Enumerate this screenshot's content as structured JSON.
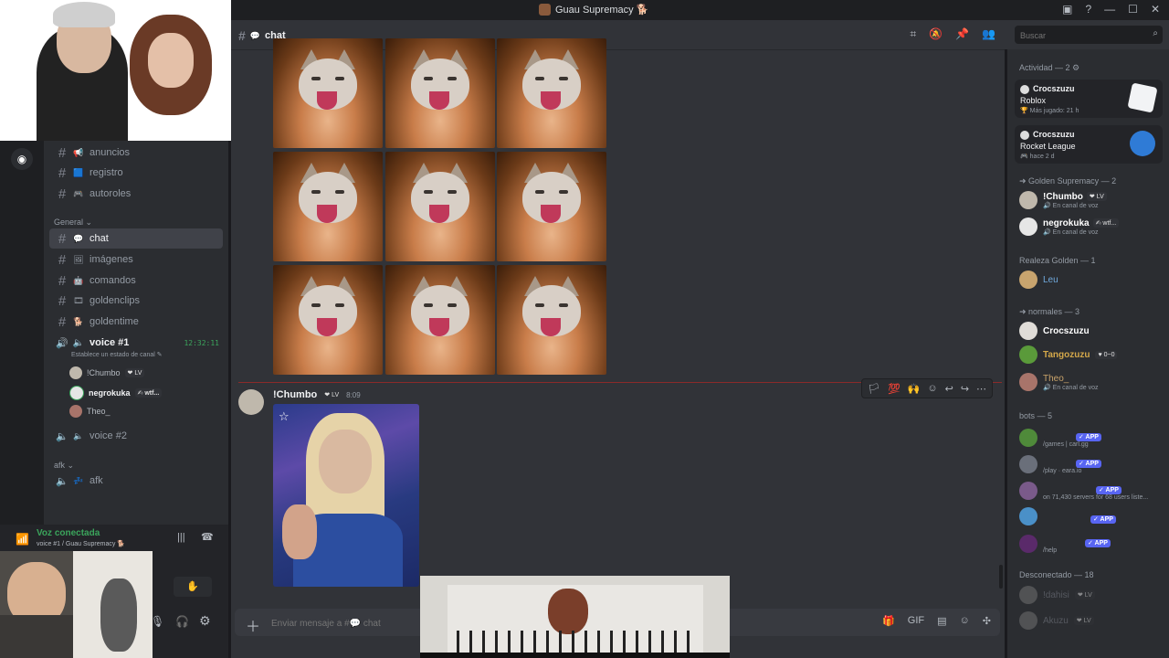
{
  "window": {
    "title": "Guau Supremacy 🐕"
  },
  "channels": {
    "items": [
      {
        "emoji": "📢",
        "name": "anuncios"
      },
      {
        "emoji": "🟦",
        "name": "registro"
      },
      {
        "emoji": "🎮",
        "name": "autoroles"
      }
    ],
    "general_label": "General ⌄",
    "general_items": [
      {
        "emoji": "💬",
        "name": "chat"
      },
      {
        "emoji": "🖼",
        "name": "imágenes"
      },
      {
        "emoji": "🤖",
        "name": "comandos"
      },
      {
        "emoji": "🎞",
        "name": "goldenclips"
      },
      {
        "emoji": "🐕",
        "name": "goldentime"
      }
    ],
    "voice1": {
      "name": "voice #1",
      "timer": "12:32:11",
      "status_prompt": "Establece un estado de canal ✎"
    },
    "voice_users": [
      {
        "name": "!Chumbo",
        "badge": "❤ LV"
      },
      {
        "name": "negrokuka",
        "badge": "✍ wtf..."
      },
      {
        "name": "Theo_",
        "badge": ""
      }
    ],
    "voice2": "voice #2",
    "afk_label": "afk ⌄",
    "afk_channel": "afk"
  },
  "voice_panel": {
    "status": "Voz conectada",
    "location": "voice #1 / Guau Supremacy 🐕"
  },
  "main": {
    "channel_name": "chat",
    "message": {
      "author": "!Chumbo",
      "badge": "❤ LV",
      "time": "8:09"
    },
    "input_placeholder": "Enviar mensaje a #💬 chat"
  },
  "search": {
    "placeholder": "Buscar"
  },
  "members": {
    "activity_header": "Actividad — 2 ⚙",
    "activity": [
      {
        "user": "Crocszuzu",
        "game": "Roblox",
        "detail": "🏆 Más jugado: 21 h"
      },
      {
        "user": "Crocszuzu",
        "game": "Rocket League",
        "detail": "🎮 hace 2 d"
      }
    ],
    "sections": [
      {
        "header": "➜ Golden Supremacy — 2",
        "members": [
          {
            "name": "!Chumbo",
            "tag": "❤ LV",
            "status": "🔊 En canal de voz",
            "color": "#ffffff"
          },
          {
            "name": "negrokuka",
            "tag": "✍ wtf...",
            "status": "🔊 En canal de voz",
            "color": "#ffffff"
          }
        ]
      },
      {
        "header": "Realeza Golden — 1",
        "members": [
          {
            "name": "Leu",
            "tag": "",
            "status": "",
            "color": "#6fa8dc"
          }
        ]
      },
      {
        "header": "➜ normales — 3",
        "members": [
          {
            "name": "Crocszuzu",
            "tag": "",
            "status": "",
            "color": "#ffffff"
          },
          {
            "name": "Tangozuzu",
            "tag": "♥ 0~0",
            "status": "",
            "color": "#d4a84a"
          },
          {
            "name": "Theo_",
            "tag": "",
            "status": "🔊 En canal de voz",
            "color": "#c9a36a"
          }
        ]
      },
      {
        "header": "bots — 5",
        "members": [
          {
            "name": "",
            "tag": "✓ APP",
            "status": "/games | carl.gg",
            "color": "#ffffff"
          },
          {
            "name": "",
            "tag": "✓ APP",
            "status": "/play · eara.io",
            "color": "#ffffff"
          },
          {
            "name": "",
            "tag": "✓ APP",
            "status": "on 71,430 servers for 68 users liste...",
            "color": "#ffffff"
          },
          {
            "name": "",
            "tag": "✓ APP",
            "status": "",
            "color": "#ffffff"
          },
          {
            "name": "",
            "tag": "✓ APP",
            "status": "/help",
            "color": "#ffffff"
          }
        ]
      },
      {
        "header": "Desconectado — 18",
        "members": [
          {
            "name": "!dahisi",
            "tag": "❤ LV",
            "status": "",
            "color": "#80848e"
          },
          {
            "name": "Akuzu",
            "tag": "❤ LV",
            "status": "",
            "color": "#80848e"
          }
        ]
      }
    ]
  }
}
